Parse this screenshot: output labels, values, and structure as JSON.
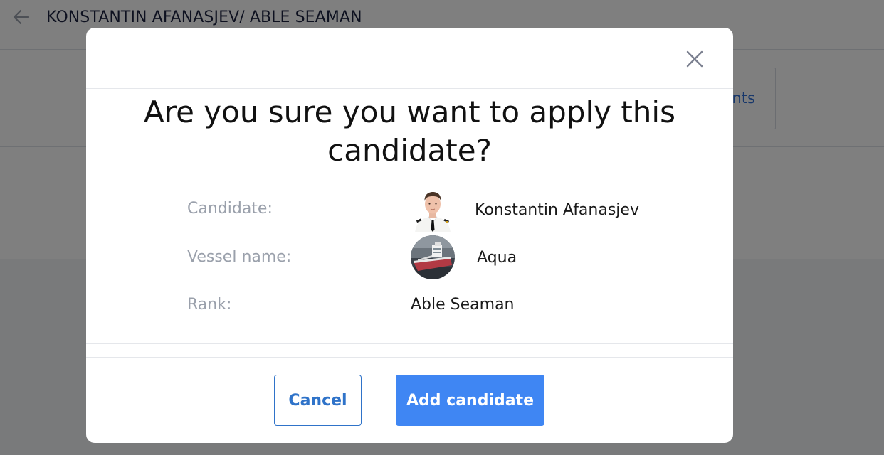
{
  "page": {
    "title": "KONSTANTIN AFANASJEV/ ABLE SEAMAN",
    "back_icon": "arrow-left-icon",
    "tab_partial_label": "nts"
  },
  "modal": {
    "close_icon": "close-icon",
    "title": "Are you sure you want to apply this candidate?",
    "fields": {
      "candidate": {
        "label": "Candidate:",
        "value": "Konstantin Afanasjev",
        "icon": "candidate-avatar"
      },
      "vessel": {
        "label": "Vessel name:",
        "value": "Aqua",
        "icon": "vessel-avatar"
      },
      "rank": {
        "label": "Rank:",
        "value": "Able Seaman"
      }
    },
    "buttons": {
      "cancel": "Cancel",
      "add": "Add candidate"
    }
  },
  "colors": {
    "accent": "#3f86f3",
    "cancel_border": "#2f73c9",
    "label_gray": "#9aa0ab",
    "overlay": "rgba(0,0,0,0.5)"
  }
}
